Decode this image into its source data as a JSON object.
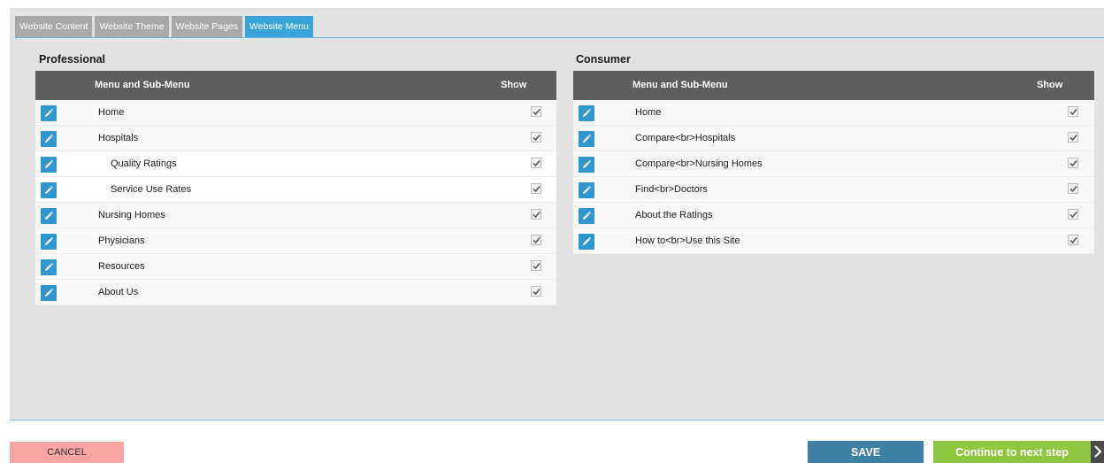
{
  "tabs": [
    {
      "label": "Website Content",
      "active": false
    },
    {
      "label": "Website Theme",
      "active": false
    },
    {
      "label": "Website Pages",
      "active": false
    },
    {
      "label": "Website Menu",
      "active": true
    }
  ],
  "professional": {
    "title": "Professional",
    "header_menu": "Menu and Sub-Menu",
    "header_show": "Show",
    "rows": [
      {
        "label": "Home",
        "sub": false,
        "checked": true
      },
      {
        "label": "Hospitals",
        "sub": false,
        "checked": true
      },
      {
        "label": "Quality Ratings",
        "sub": true,
        "checked": true
      },
      {
        "label": "Service Use Rates",
        "sub": true,
        "checked": true
      },
      {
        "label": "Nursing Homes",
        "sub": false,
        "checked": true
      },
      {
        "label": "Physicians",
        "sub": false,
        "checked": true
      },
      {
        "label": "Resources",
        "sub": false,
        "checked": true
      },
      {
        "label": "About Us",
        "sub": false,
        "checked": true
      }
    ]
  },
  "consumer": {
    "title": "Consumer",
    "header_menu": "Menu and Sub-Menu",
    "header_show": "Show",
    "rows": [
      {
        "label": "Home",
        "sub": false,
        "checked": true
      },
      {
        "label": "Compare<br>Hospitals",
        "sub": false,
        "checked": true
      },
      {
        "label": "Compare<br>Nursing Homes",
        "sub": false,
        "checked": true
      },
      {
        "label": "Find<br>Doctors",
        "sub": false,
        "checked": true
      },
      {
        "label": "About the Ratings",
        "sub": false,
        "checked": true
      },
      {
        "label": "How to<br>Use this Site",
        "sub": false,
        "checked": true
      }
    ]
  },
  "footer": {
    "cancel_label": "CANCEL",
    "save_label": "SAVE",
    "next_label": "Continue to next step"
  },
  "colors": {
    "tab_active": "#3aa3d8",
    "tab_inactive": "#a9a9a9",
    "edit_icon_bg": "#2f96d2",
    "grid_header": "#5e5e5e",
    "cancel": "#f8a4a4",
    "save": "#3d82a6",
    "next": "#8dc63f"
  },
  "icons": {
    "edit": "pencil-icon",
    "check": "check-icon",
    "next": "chevron-right-icon"
  }
}
